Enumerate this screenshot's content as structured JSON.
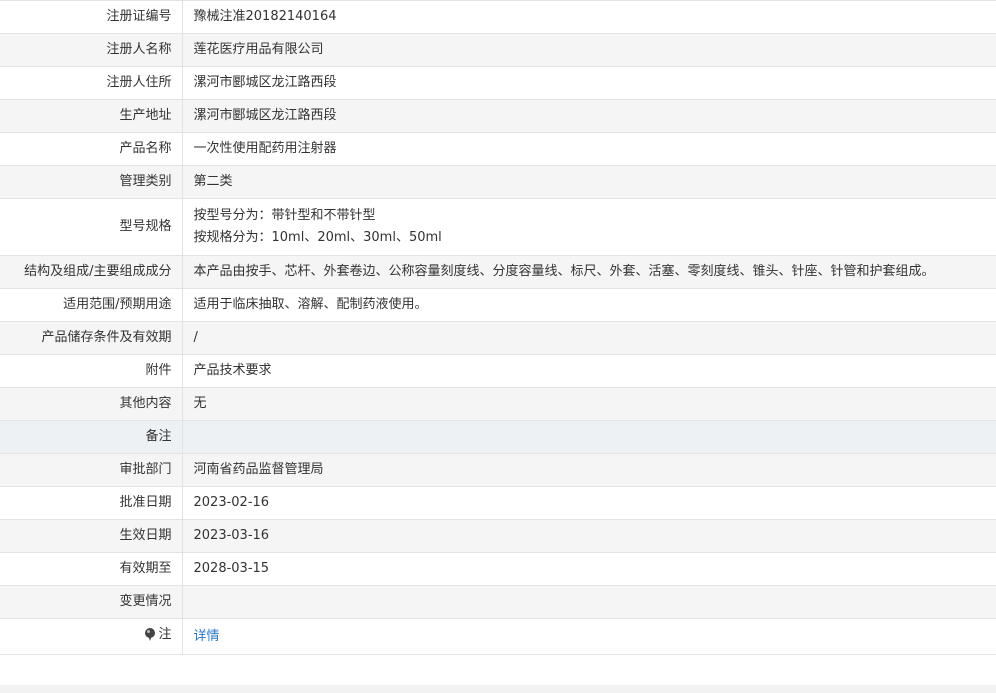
{
  "rows": [
    {
      "label": "注册证编号",
      "value": "豫械注准20182140164"
    },
    {
      "label": "注册人名称",
      "value": "莲花医疗用品有限公司"
    },
    {
      "label": "注册人住所",
      "value": "漯河市郾城区龙江路西段"
    },
    {
      "label": "生产地址",
      "value": "漯河市郾城区龙江路西段"
    },
    {
      "label": "产品名称",
      "value": "一次性使用配药用注射器"
    },
    {
      "label": "管理类别",
      "value": "第二类"
    },
    {
      "label": "型号规格",
      "lines": [
        "按型号分为：带针型和不带针型",
        "按规格分为：10ml、20ml、30ml、50ml"
      ]
    },
    {
      "label": "结构及组成/主要组成成分",
      "value": "本产品由按手、芯杆、外套卷边、公称容量刻度线、分度容量线、标尺、外套、活塞、零刻度线、锥头、针座、针管和护套组成。"
    },
    {
      "label": "适用范围/预期用途",
      "value": "适用于临床抽取、溶解、配制药液使用。"
    },
    {
      "label": "产品储存条件及有效期",
      "value": "/"
    },
    {
      "label": "附件",
      "value": "产品技术要求"
    },
    {
      "label": "其他内容",
      "value": "无"
    },
    {
      "label": "备注",
      "value": ""
    },
    {
      "label": "审批部门",
      "value": "河南省药品监督管理局"
    },
    {
      "label": "批准日期",
      "value": "2023-02-16"
    },
    {
      "label": "生效日期",
      "value": "2023-03-16"
    },
    {
      "label": "有效期至",
      "value": "2028-03-15"
    },
    {
      "label": "变更情况",
      "value": ""
    }
  ],
  "note": {
    "label": "注",
    "icon": "pin-icon",
    "link_text": "详情"
  },
  "colors": {
    "link": "#2a78c8",
    "row_alt": "#f5f5f5",
    "border": "#e3e3e3"
  }
}
